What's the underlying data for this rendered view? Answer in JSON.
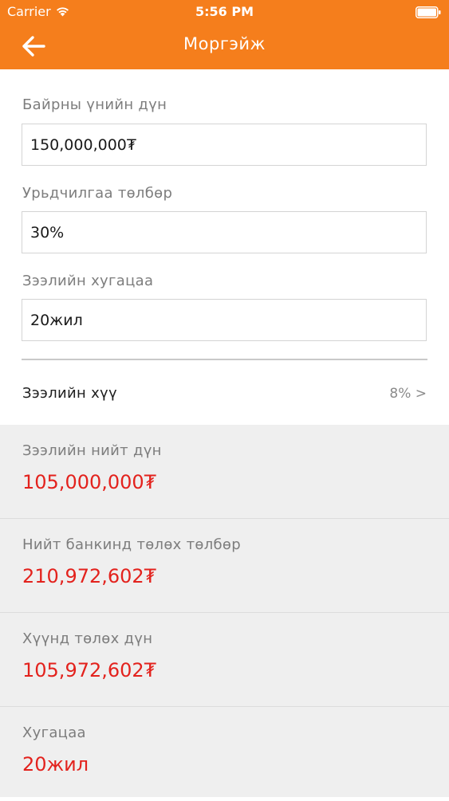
{
  "status_bar": {
    "carrier": "Carrier",
    "time": "5:56 PM",
    "wifi_icon": "wifi-icon",
    "battery_icon": "battery-icon"
  },
  "nav": {
    "title": "Моргэйж",
    "back_icon": "arrow-left-icon"
  },
  "form": {
    "price_label": "Байрны үнийн дүн",
    "price_value": "150,000,000₮",
    "down_payment_label": "Урьдчилгаа төлбөр",
    "down_payment_value": "30%",
    "term_label": "Зээлийн хугацаа",
    "term_value": "20жил",
    "rate_label": "Зээлийн хүү",
    "rate_value": "8% >"
  },
  "results": [
    {
      "label": "Зээлийн нийт дүн",
      "value": "105,000,000₮"
    },
    {
      "label": "Нийт банкинд төлөх төлбөр",
      "value": "210,972,602₮"
    },
    {
      "label": "Хүүнд төлөх дүн",
      "value": "105,972,602₮"
    },
    {
      "label": "Хугацаа",
      "value": "20жил"
    }
  ],
  "colors": {
    "header": "#f57e1c",
    "result_value": "#e3221d",
    "results_background": "#efefef"
  }
}
